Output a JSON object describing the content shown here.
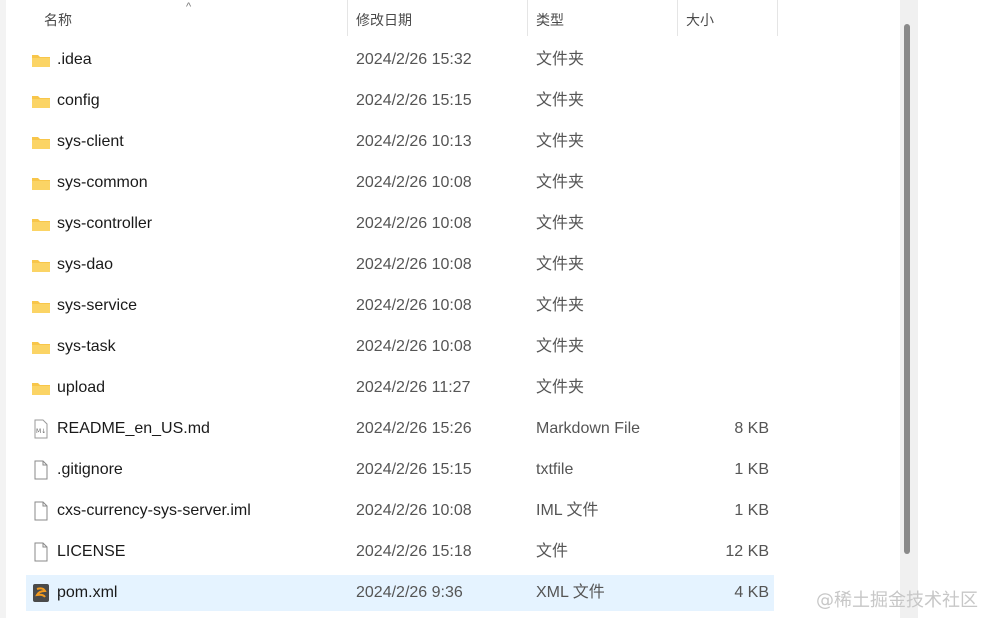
{
  "columns": {
    "name": "名称",
    "date": "修改日期",
    "type": "类型",
    "size": "大小"
  },
  "files": [
    {
      "name": ".idea",
      "date": "2024/2/26 15:32",
      "type": "文件夹",
      "size": "",
      "icon": "folder-icon"
    },
    {
      "name": "config",
      "date": "2024/2/26 15:15",
      "type": "文件夹",
      "size": "",
      "icon": "folder-icon"
    },
    {
      "name": "sys-client",
      "date": "2024/2/26 10:13",
      "type": "文件夹",
      "size": "",
      "icon": "folder-icon"
    },
    {
      "name": "sys-common",
      "date": "2024/2/26 10:08",
      "type": "文件夹",
      "size": "",
      "icon": "folder-icon"
    },
    {
      "name": "sys-controller",
      "date": "2024/2/26 10:08",
      "type": "文件夹",
      "size": "",
      "icon": "folder-icon"
    },
    {
      "name": "sys-dao",
      "date": "2024/2/26 10:08",
      "type": "文件夹",
      "size": "",
      "icon": "folder-icon"
    },
    {
      "name": "sys-service",
      "date": "2024/2/26 10:08",
      "type": "文件夹",
      "size": "",
      "icon": "folder-icon"
    },
    {
      "name": "sys-task",
      "date": "2024/2/26 10:08",
      "type": "文件夹",
      "size": "",
      "icon": "folder-icon"
    },
    {
      "name": "upload",
      "date": "2024/2/26 11:27",
      "type": "文件夹",
      "size": "",
      "icon": "folder-icon"
    },
    {
      "name": "README_en_US.md",
      "date": "2024/2/26 15:26",
      "type": "Markdown File",
      "size": "8 KB",
      "icon": "markdown-file-icon"
    },
    {
      "name": ".gitignore",
      "date": "2024/2/26 15:15",
      "type": "txtfile",
      "size": "1 KB",
      "icon": "file-icon"
    },
    {
      "name": "cxs-currency-sys-server.iml",
      "date": "2024/2/26 10:08",
      "type": "IML 文件",
      "size": "1 KB",
      "icon": "file-icon"
    },
    {
      "name": "LICENSE",
      "date": "2024/2/26 15:18",
      "type": "文件",
      "size": "12 KB",
      "icon": "file-icon"
    },
    {
      "name": "pom.xml",
      "date": "2024/2/26 9:36",
      "type": "XML 文件",
      "size": "4 KB",
      "icon": "xml-file-icon",
      "selected": true
    }
  ],
  "sort_indicator": "^",
  "watermark": "@稀土掘金技术社区",
  "colors": {
    "folder": "#f8c64a",
    "selected_row": "#e5f3ff",
    "xml_icon": "#f29a1f"
  }
}
